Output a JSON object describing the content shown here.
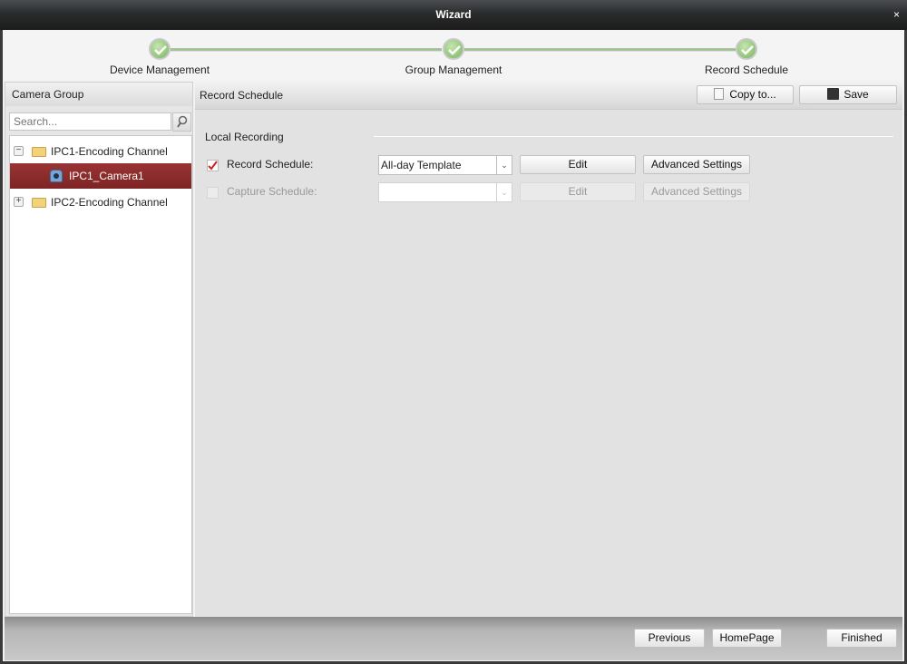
{
  "window": {
    "title": "Wizard",
    "close": "×"
  },
  "steps": [
    {
      "label": "Device Management",
      "status": "completed"
    },
    {
      "label": "Group Management",
      "status": "completed"
    },
    {
      "label": "Record Schedule",
      "status": "completed"
    }
  ],
  "sidebar": {
    "title": "Camera Group",
    "search_placeholder": "Search...",
    "tree": [
      {
        "label": "IPC1-Encoding Channel",
        "expander": "−",
        "expanded": true
      },
      {
        "label": "IPC1_Camera1",
        "selected": true
      },
      {
        "label": "IPC2-Encoding Channel",
        "expander": "+",
        "expanded": false
      }
    ]
  },
  "main": {
    "title": "Record Schedule",
    "copy_label": "Copy to...",
    "save_label": "Save",
    "section": "Local Recording",
    "rows": [
      {
        "label": "Record Schedule:",
        "checked": true,
        "value": "All-day Template",
        "edit": "Edit",
        "advanced": "Advanced Settings",
        "enabled": true
      },
      {
        "label": "Capture Schedule:",
        "checked": false,
        "value": "",
        "edit": "Edit",
        "advanced": "Advanced Settings",
        "enabled": false
      }
    ]
  },
  "footer": {
    "previous": "Previous",
    "homepage": "HomePage",
    "finished": "Finished"
  },
  "colors": {
    "selected_row": "#8a2b2b",
    "step_complete": "#79b45f",
    "checkmark": "#cc2222"
  }
}
